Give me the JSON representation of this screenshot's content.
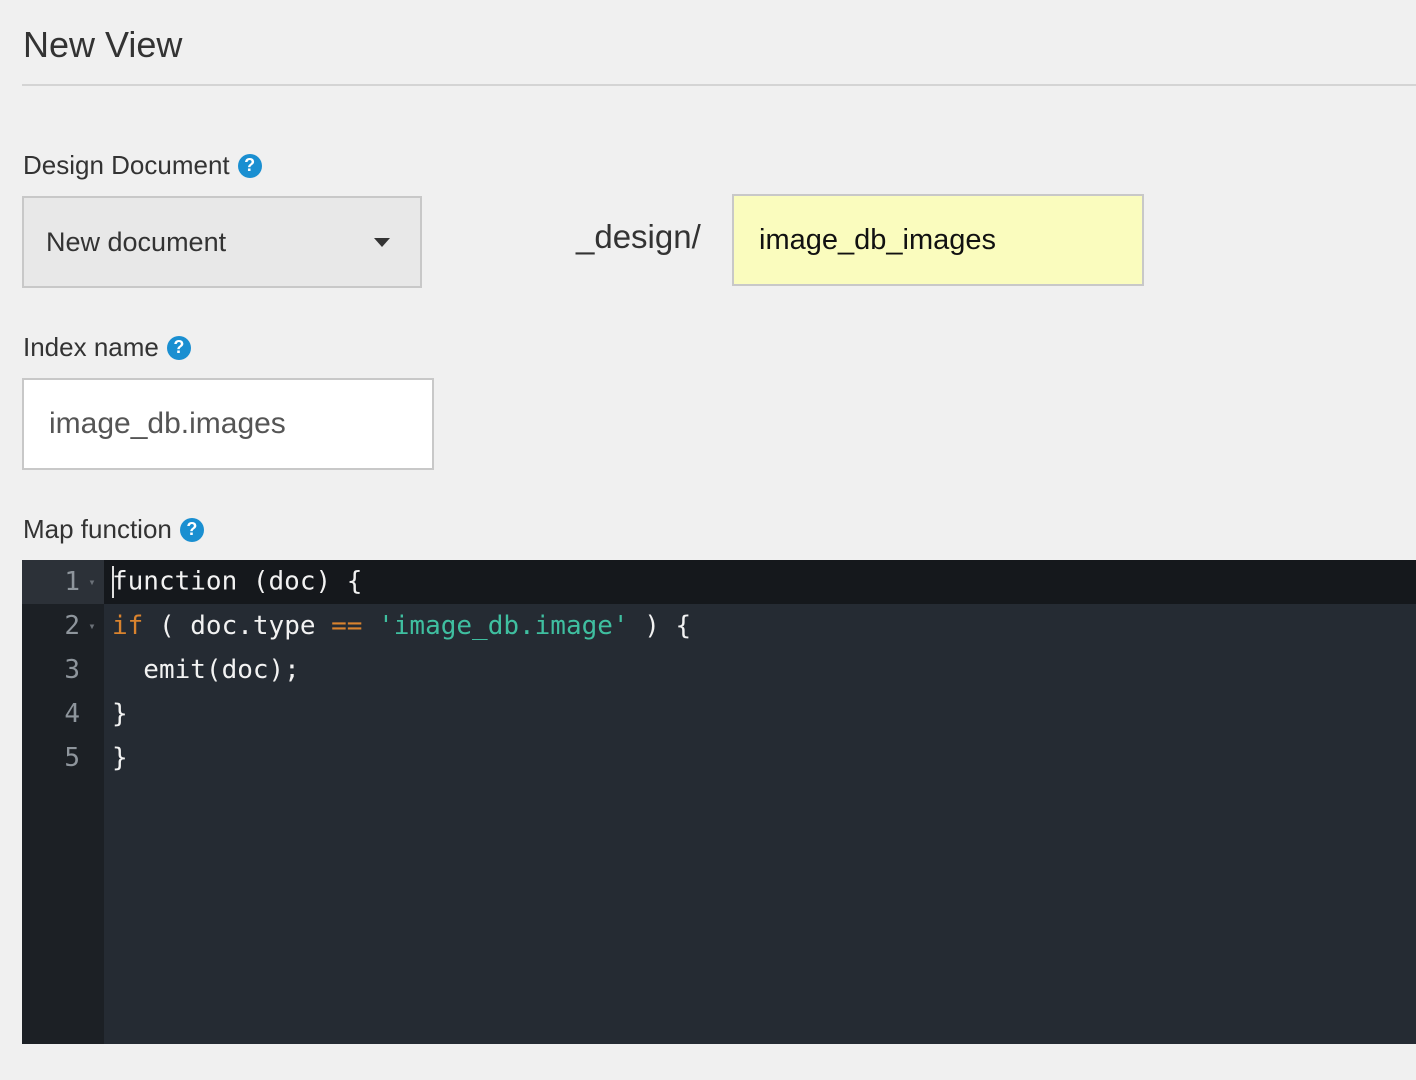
{
  "header": {
    "title": "New View"
  },
  "design_document": {
    "label": "Design Document",
    "help_glyph": "?",
    "select_value": "New document",
    "prefix": "_design/",
    "name_value": "image_db_images"
  },
  "index_name": {
    "label": "Index name",
    "help_glyph": "?",
    "value": "image_db.images"
  },
  "map_function": {
    "label": "Map function",
    "help_glyph": "?",
    "lines": [
      {
        "number": "1",
        "fold": "▾"
      },
      {
        "number": "2",
        "fold": "▾"
      },
      {
        "number": "3",
        "fold": ""
      },
      {
        "number": "4",
        "fold": ""
      },
      {
        "number": "5",
        "fold": ""
      }
    ],
    "code": {
      "l1": "function (doc) {",
      "l2_kw": "if",
      "l2_a": " ( doc.type ",
      "l2_op": "==",
      "l2_b": " ",
      "l2_str": "'image_db.image'",
      "l2_c": " ) {",
      "l3": "  emit(doc);",
      "l4": "}",
      "l5": "}"
    }
  },
  "colors": {
    "help_icon": "#1a8fd1",
    "highlighted_input": "#fafcbe",
    "editor_bg": "#252b33",
    "keyword": "#d9832e",
    "string": "#3fbfa0"
  },
  "icons": {
    "help": "question-circle-icon",
    "dropdown": "caret-down-icon"
  }
}
